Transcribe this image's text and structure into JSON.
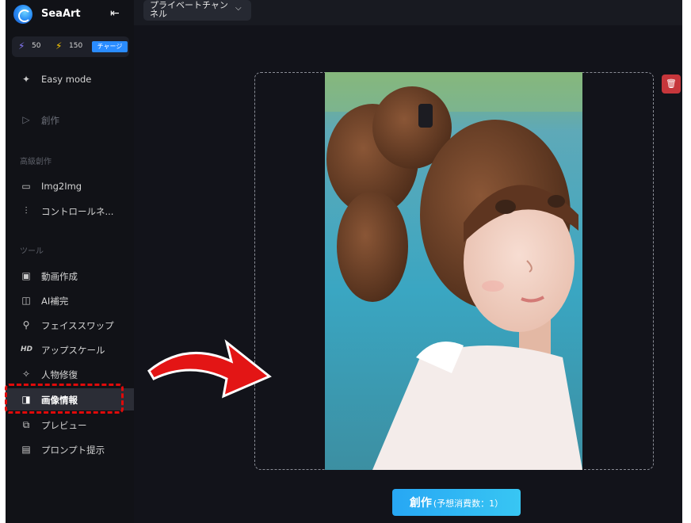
{
  "sidebar": {
    "brand": "SeaArt",
    "collapse_icon": "collapse-left-icon",
    "credits": {
      "a": "50",
      "b": "150",
      "charge_label": "チャージ"
    },
    "items": [
      {
        "label": "Easy mode",
        "icon": "sparkle-icon"
      },
      {
        "label": "創作",
        "icon": "play-icon"
      }
    ],
    "section_advanced": "高級創作",
    "advanced_items": [
      {
        "label": "Img2Img",
        "icon": "image-icon"
      },
      {
        "label": "コントロールネ...",
        "icon": "sliders-icon"
      }
    ],
    "section_tools": "ツール",
    "tools": [
      {
        "label": "動画作成",
        "icon": "video-icon"
      },
      {
        "label": "AI補完",
        "icon": "inpaint-icon"
      },
      {
        "label": "フェイススワップ",
        "icon": "faceswap-icon"
      },
      {
        "label": "アップスケール",
        "icon": "hd-icon"
      },
      {
        "label": "人物修復",
        "icon": "magic-wand-icon"
      },
      {
        "label": "画像情報",
        "icon": "book-icon"
      },
      {
        "label": "プレビュー",
        "icon": "preview-icon"
      },
      {
        "label": "プロンプト提示",
        "icon": "prompt-icon"
      }
    ]
  },
  "topbar": {
    "channel_label": "プライベートチャンネル"
  },
  "canvas": {
    "action": {
      "label": "創作",
      "cost": "(予想消費数：1）"
    }
  },
  "colors": {
    "accent": "#2a8cff",
    "highlight": "#e00a0a",
    "delete": "#c6363b"
  }
}
